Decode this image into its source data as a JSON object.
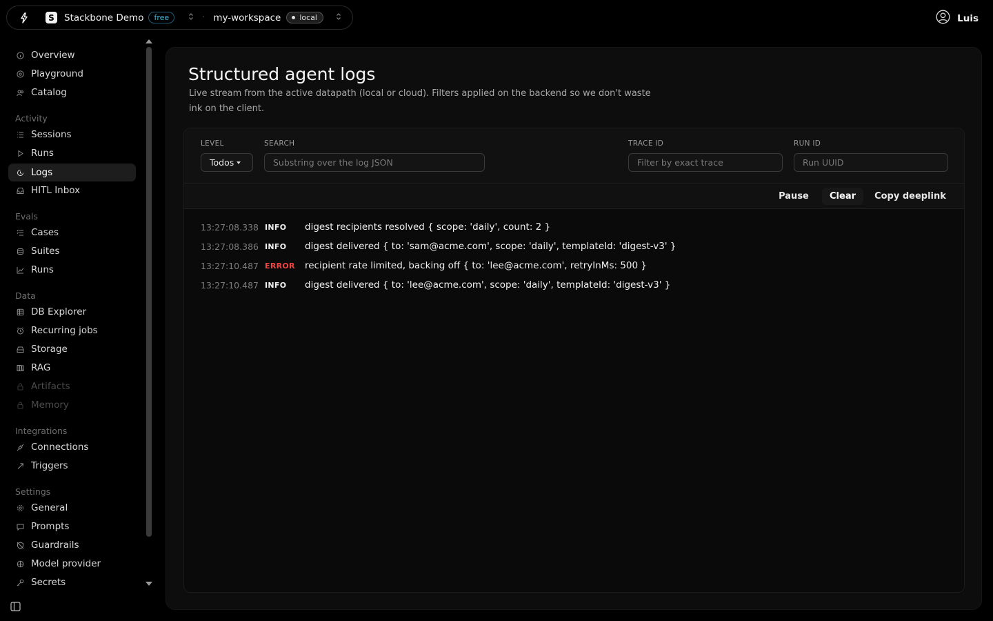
{
  "topbar": {
    "org_name": "Stackbone Demo",
    "org_logo_letter": "S",
    "plan_badge": "free",
    "workspace_name": "my-workspace",
    "env_badge": "local",
    "user_name": "Luis"
  },
  "sidebar": {
    "top_items": [
      {
        "label": "Overview",
        "icon": "info-circle-icon"
      },
      {
        "label": "Playground",
        "icon": "target-icon"
      },
      {
        "label": "Catalog",
        "icon": "users-icon"
      }
    ],
    "sections": [
      {
        "title": "Activity",
        "items": [
          {
            "label": "Sessions",
            "icon": "list-icon"
          },
          {
            "label": "Runs",
            "icon": "play-icon"
          },
          {
            "label": "Logs",
            "icon": "logs-icon",
            "active": true
          },
          {
            "label": "HITL Inbox",
            "icon": "inbox-icon"
          }
        ]
      },
      {
        "title": "Evals",
        "items": [
          {
            "label": "Cases",
            "icon": "list-check-icon"
          },
          {
            "label": "Suites",
            "icon": "stack-icon"
          },
          {
            "label": "Runs",
            "icon": "chart-icon"
          }
        ]
      },
      {
        "title": "Data",
        "items": [
          {
            "label": "DB Explorer",
            "icon": "database-icon"
          },
          {
            "label": "Recurring jobs",
            "icon": "clock-icon"
          },
          {
            "label": "Storage",
            "icon": "drive-icon"
          },
          {
            "label": "RAG",
            "icon": "books-icon"
          },
          {
            "label": "Artifacts",
            "icon": "artifact-icon",
            "disabled": true
          },
          {
            "label": "Memory",
            "icon": "memory-icon",
            "disabled": true
          }
        ]
      },
      {
        "title": "Integrations",
        "items": [
          {
            "label": "Connections",
            "icon": "plug-icon"
          },
          {
            "label": "Triggers",
            "icon": "bolt-icon"
          }
        ]
      },
      {
        "title": "Settings",
        "items": [
          {
            "label": "General",
            "icon": "gear-icon"
          },
          {
            "label": "Prompts",
            "icon": "chat-icon"
          },
          {
            "label": "Guardrails",
            "icon": "shield-off-icon"
          },
          {
            "label": "Model provider",
            "icon": "model-icon"
          },
          {
            "label": "Secrets",
            "icon": "key-icon"
          }
        ]
      }
    ]
  },
  "page": {
    "title": "Structured agent logs",
    "description": "Live stream from the active datapath (local or cloud). Filters applied on the backend so we don't waste ink on the client."
  },
  "filters": {
    "level_label": "LEVEL",
    "level_value": "Todos",
    "search_label": "SEARCH",
    "search_placeholder": "Substring over the log JSON",
    "trace_label": "TRACE ID",
    "trace_placeholder": "Filter by exact trace",
    "run_label": "RUN ID",
    "run_placeholder": "Run UUID"
  },
  "actions": {
    "pause": "Pause",
    "clear": "Clear",
    "copy_deeplink": "Copy deeplink"
  },
  "logs": [
    {
      "time": "13:27:08.338",
      "level": "INFO",
      "message": "digest recipients resolved { scope: 'daily', count: 2 }"
    },
    {
      "time": "13:27:08.386",
      "level": "INFO",
      "message": "digest delivered { to: 'sam@acme.com', scope: 'daily', templateId: 'digest-v3' }"
    },
    {
      "time": "13:27:10.487",
      "level": "ERROR",
      "message": "recipient rate limited, backing off { to: 'lee@acme.com', retryInMs: 500 }"
    },
    {
      "time": "13:27:10.487",
      "level": "INFO",
      "message": "digest delivered { to: 'lee@acme.com', scope: 'daily', templateId: 'digest-v3' }"
    }
  ],
  "colors": {
    "background": "#000000",
    "card": "#0d0d0d",
    "error": "#ef4444",
    "plan_badge": "#3fb6e0"
  }
}
